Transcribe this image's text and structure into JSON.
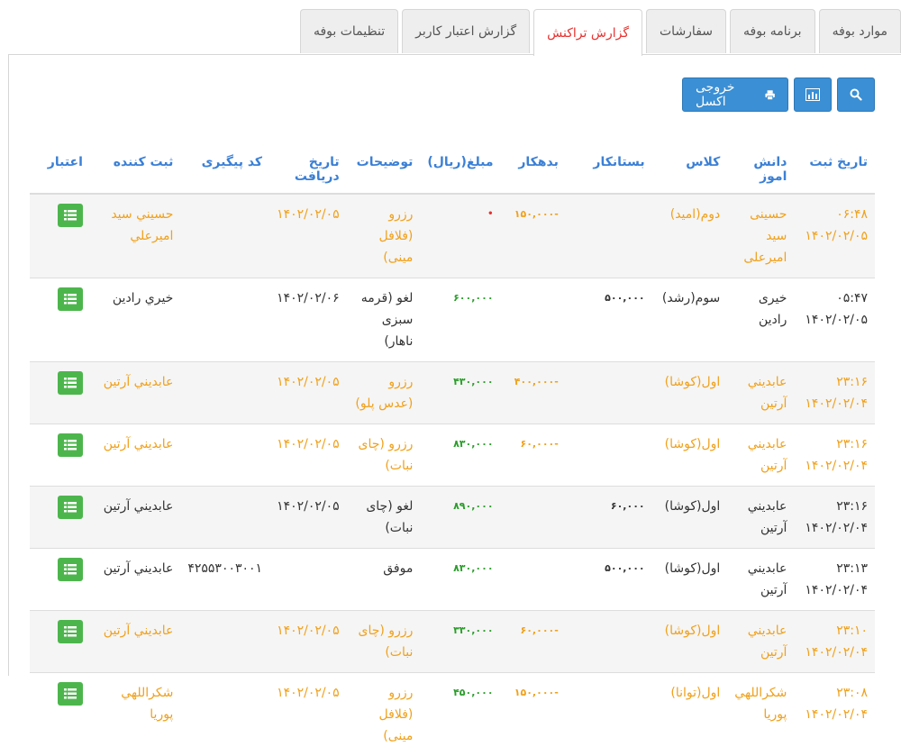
{
  "tabs": [
    {
      "label": "موارد بوفه",
      "active": false
    },
    {
      "label": "برنامه بوفه",
      "active": false
    },
    {
      "label": "سفارشات",
      "active": false
    },
    {
      "label": "گزارش تراکنش",
      "active": true
    },
    {
      "label": "گزارش اعتبار کاربر",
      "active": false
    },
    {
      "label": "تنظیمات بوفه",
      "active": false
    }
  ],
  "toolbar": {
    "excel_label": "خروجی اکسل",
    "search_icon": "search-icon",
    "chart_icon": "bar-chart-icon",
    "print_icon": "print-icon"
  },
  "table": {
    "headers": {
      "date": "تاریخ ثبت",
      "student": "دانش اموز",
      "class": "کلاس",
      "creditor": "بستانکار",
      "debtor": "بدهکار",
      "amount": "مبلغ(ریال)",
      "desc": "توضیحات",
      "recv_date": "تاریخ دریافت",
      "tracking": "کد پیگیری",
      "registrar": "ثبت کننده",
      "credit": "اعتبار"
    },
    "rows": [
      {
        "time": "۰۶:۴۸",
        "date": "۱۴۰۲/۰۲/۰۵",
        "student": "حسینی سید امیرعلی",
        "class": "دوم(امید)",
        "creditor": "",
        "debtor": "-۱۵۰,۰۰۰",
        "amount": "•",
        "desc": "رزرو (فلافل مینی)",
        "recv_date": "۱۴۰۲/۰۲/۰۵",
        "tracking": "",
        "registrar": "حسيني سيد اميرعلي",
        "style": "orange"
      },
      {
        "time": "۰۵:۴۷",
        "date": "۱۴۰۲/۰۲/۰۵",
        "student": "خیری رادین",
        "class": "سوم(رشد)",
        "creditor": "۵۰۰,۰۰۰",
        "debtor": "",
        "amount": "۶۰۰,۰۰۰",
        "desc": "لغو (قرمه سبزی ناهار)",
        "recv_date": "۱۴۰۲/۰۲/۰۶",
        "tracking": "",
        "registrar": "خيري رادين",
        "style": "dark"
      },
      {
        "time": "۲۳:۱۶",
        "date": "۱۴۰۲/۰۲/۰۴",
        "student": "عابديني آرتين",
        "class": "اول(کوشا)",
        "creditor": "",
        "debtor": "-۴۰۰,۰۰۰",
        "amount": "۴۳۰,۰۰۰",
        "desc": "رزرو (عدس پلو)",
        "recv_date": "۱۴۰۲/۰۲/۰۵",
        "tracking": "",
        "registrar": "عابديني آرتين",
        "style": "orange"
      },
      {
        "time": "۲۳:۱۶",
        "date": "۱۴۰۲/۰۲/۰۴",
        "student": "عابديني آرتين",
        "class": "اول(کوشا)",
        "creditor": "",
        "debtor": "-۶۰,۰۰۰",
        "amount": "۸۳۰,۰۰۰",
        "desc": "رزرو (چای نبات)",
        "recv_date": "۱۴۰۲/۰۲/۰۵",
        "tracking": "",
        "registrar": "عابديني آرتين",
        "style": "orange"
      },
      {
        "time": "۲۳:۱۶",
        "date": "۱۴۰۲/۰۲/۰۴",
        "student": "عابديني آرتين",
        "class": "اول(کوشا)",
        "creditor": "۶۰,۰۰۰",
        "debtor": "",
        "amount": "۸۹۰,۰۰۰",
        "desc": "لغو (چای نبات)",
        "recv_date": "۱۴۰۲/۰۲/۰۵",
        "tracking": "",
        "registrar": "عابديني آرتين",
        "style": "dark"
      },
      {
        "time": "۲۳:۱۳",
        "date": "۱۴۰۲/۰۲/۰۴",
        "student": "عابديني آرتين",
        "class": "اول(کوشا)",
        "creditor": "۵۰۰,۰۰۰",
        "debtor": "",
        "amount": "۸۳۰,۰۰۰",
        "desc": "موفق",
        "recv_date": "",
        "tracking": "۴۲۵۵۳۰۰۳۰۰۱",
        "registrar": "عابديني آرتين",
        "style": "dark"
      },
      {
        "time": "۲۳:۱۰",
        "date": "۱۴۰۲/۰۲/۰۴",
        "student": "عابديني آرتين",
        "class": "اول(کوشا)",
        "creditor": "",
        "debtor": "-۶۰,۰۰۰",
        "amount": "۳۳۰,۰۰۰",
        "desc": "رزرو (چای نبات)",
        "recv_date": "۱۴۰۲/۰۲/۰۵",
        "tracking": "",
        "registrar": "عابديني آرتين",
        "style": "orange"
      },
      {
        "time": "۲۳:۰۸",
        "date": "۱۴۰۲/۰۲/۰۴",
        "student": "شکراللهي پوريا",
        "class": "اول(توانا)",
        "creditor": "",
        "debtor": "-۱۵۰,۰۰۰",
        "amount": "۴۵۰,۰۰۰",
        "desc": "رزرو (فلافل مینی)",
        "recv_date": "۱۴۰۲/۰۲/۰۵",
        "tracking": "",
        "registrar": "شکراللهي پوريا",
        "style": "orange"
      }
    ]
  }
}
